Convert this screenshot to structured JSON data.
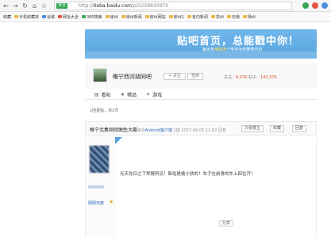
{
  "browser": {
    "secure_label": "安全",
    "url_prefix": "http://",
    "url_domain": "tieba.baidu.com",
    "url_path": "/p/5258830970"
  },
  "bookmarks": [
    {
      "label": "收藏"
    },
    {
      "label": "手机收藏夹"
    },
    {
      "label": "谷歌"
    },
    {
      "label": "网址大全"
    },
    {
      "label": "360搜索"
    },
    {
      "label": "徐州"
    },
    {
      "label": "徐州新闻"
    },
    {
      "label": "徐州网站"
    },
    {
      "label": "徐州1"
    },
    {
      "label": "省内新闻"
    },
    {
      "label": "苏州"
    },
    {
      "label": "无锡"
    },
    {
      "label": "扬州"
    }
  ],
  "banner": {
    "title": "贴吧首页，总能戳中你！",
    "sub_prefix": "每天有",
    "sub_highlight": "450万",
    "sub_suffix": "个吧中为你推荐内容"
  },
  "forum": {
    "name": "睢宁西河胡同吧",
    "follow_label": "+ 关注",
    "signin_label": "签到",
    "stats_prefix": "关注：",
    "followers": "6,076",
    "stats_mid": "  帖子：",
    "posts": "143,370"
  },
  "tabs": [
    {
      "icon": "▤",
      "label": "看帖"
    },
    {
      "icon": "★",
      "label": "精品"
    },
    {
      "icon": "✦",
      "label": "游戏"
    }
  ],
  "crumb": "1回复贴，共1页",
  "thread": {
    "title": "睢宁北集刚刚发生大事",
    "only_author": "只看楼主",
    "collect": "收藏",
    "reply": "回复"
  },
  "post": {
    "author_meta": "刚刚无痕",
    "body": "光天化日之下举报所见！新站是偷小孩的！车子在前身的东上四位开！",
    "share": "分享",
    "footer_prefix": "举报 | 1楼 来自",
    "footer_link": "Android客户端",
    "footer_suffix": " 1楼  2017-08-05 11:52  回复"
  }
}
